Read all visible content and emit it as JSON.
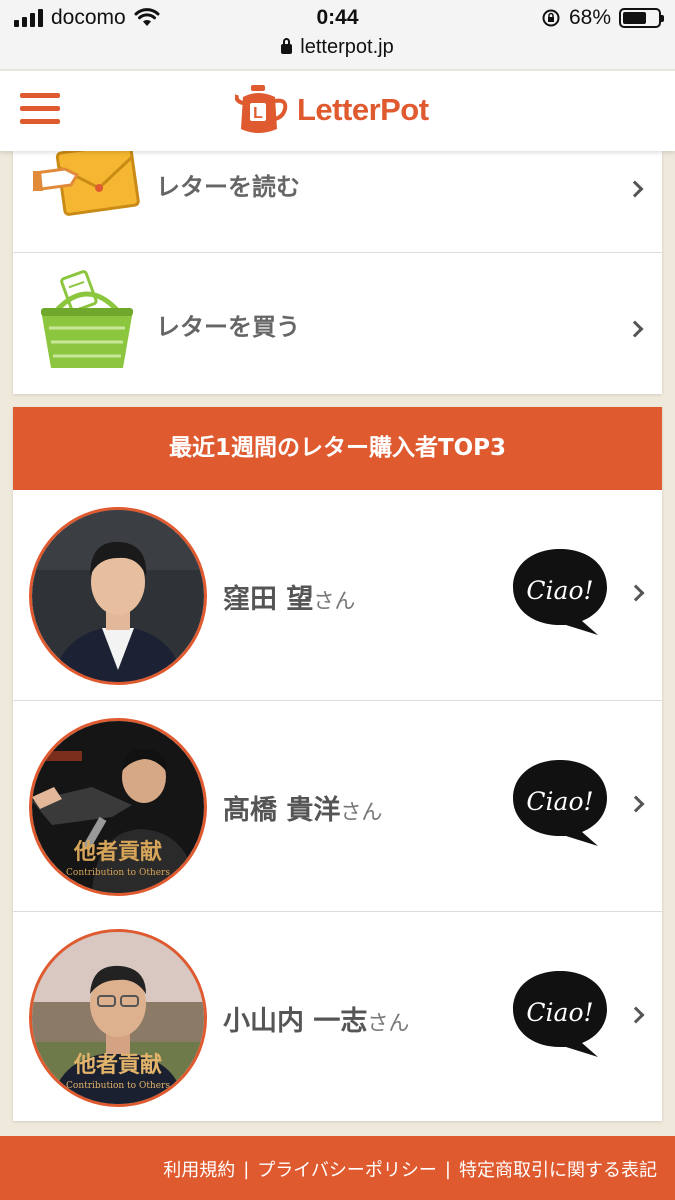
{
  "status_bar": {
    "carrier": "docomo",
    "time": "0:44",
    "url": "letterpot.jp",
    "battery": "68%",
    "battery_level": 0.68
  },
  "header": {
    "logo_text": "LetterPot"
  },
  "menu": {
    "items": [
      {
        "label": "レターを読む",
        "icon": "envelope-hand-icon"
      },
      {
        "label": "レターを買う",
        "icon": "basket-icon"
      }
    ]
  },
  "top3": {
    "title": "最近1週間のレター購入者TOP3",
    "buyers": [
      {
        "name": "窪田 望",
        "suffix": "さん",
        "badge": "Ciao!"
      },
      {
        "name": "髙橋 貴洋",
        "suffix": "さん",
        "badge": "Ciao!",
        "avatar_caption": "他者貢献",
        "avatar_subcaption": "Contribution to Others"
      },
      {
        "name": "小山内 一志",
        "suffix": "さん",
        "badge": "Ciao!",
        "avatar_caption": "他者貢献",
        "avatar_subcaption": "Contribution to Others"
      }
    ]
  },
  "footer": {
    "links": [
      "利用規約",
      "プライバシーポリシー",
      "特定商取引に関する表記"
    ],
    "separator": "|"
  },
  "colors": {
    "brand": "#e05a30",
    "background": "#efe9dc",
    "basket": "#8cc63f",
    "envelope": "#f5b731"
  }
}
